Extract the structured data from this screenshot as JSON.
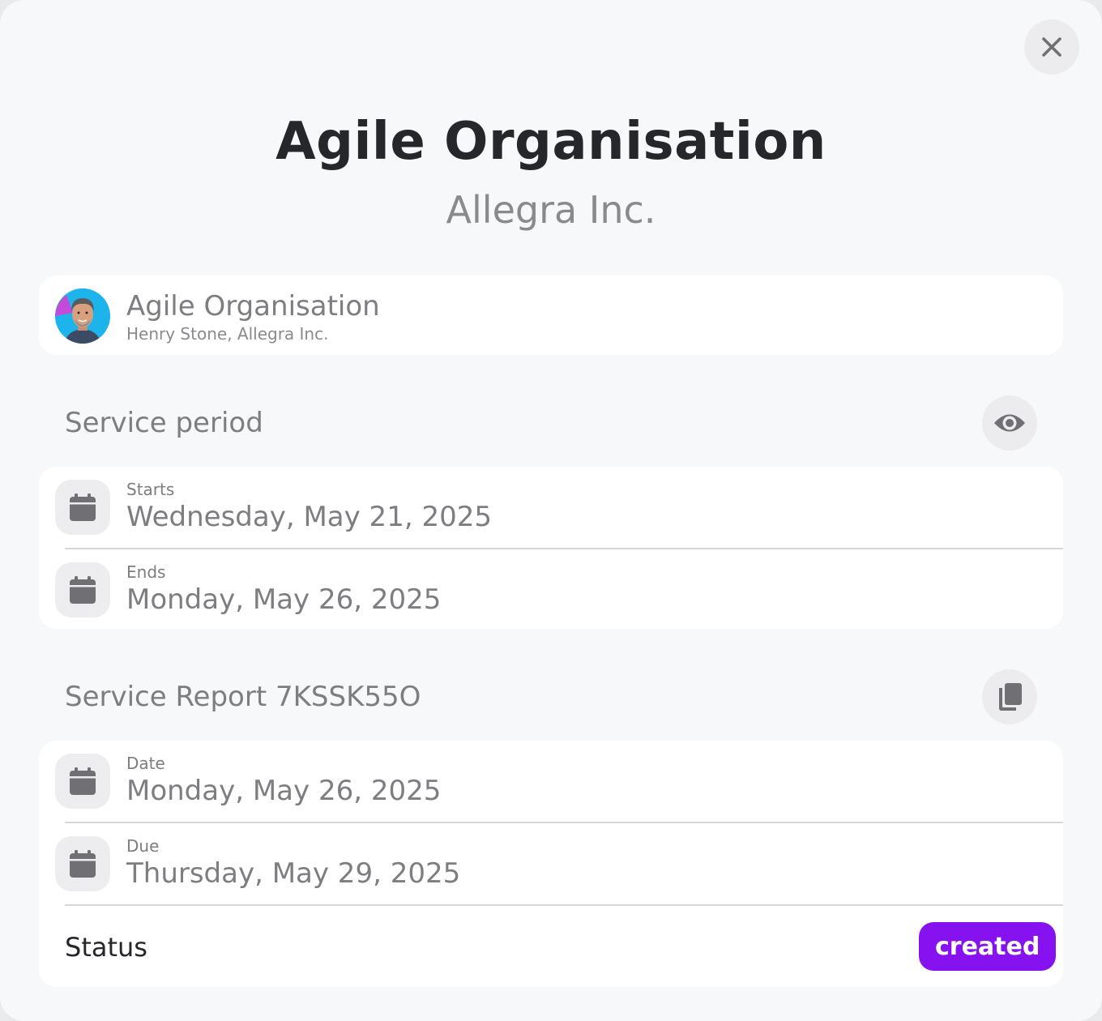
{
  "header": {
    "title": "Agile Organisation",
    "subtitle": "Allegra Inc."
  },
  "org_card": {
    "name": "Agile Organisation",
    "contact": "Henry Stone, Allegra Inc."
  },
  "service_period": {
    "title": "Service period",
    "action_icon": "eye-icon",
    "rows": [
      {
        "label": "Starts",
        "value": "Wednesday, May 21, 2025"
      },
      {
        "label": "Ends",
        "value": "Monday, May 26, 2025"
      }
    ]
  },
  "service_report": {
    "title": "Service Report 7KSSK55O",
    "action_icon": "copy-icon",
    "rows": [
      {
        "label": "Date",
        "value": "Monday, May 26, 2025"
      },
      {
        "label": "Due",
        "value": "Thursday, May 29, 2025"
      }
    ],
    "status_label": "Status",
    "status_value": "created",
    "status_color": "#8612f0"
  }
}
